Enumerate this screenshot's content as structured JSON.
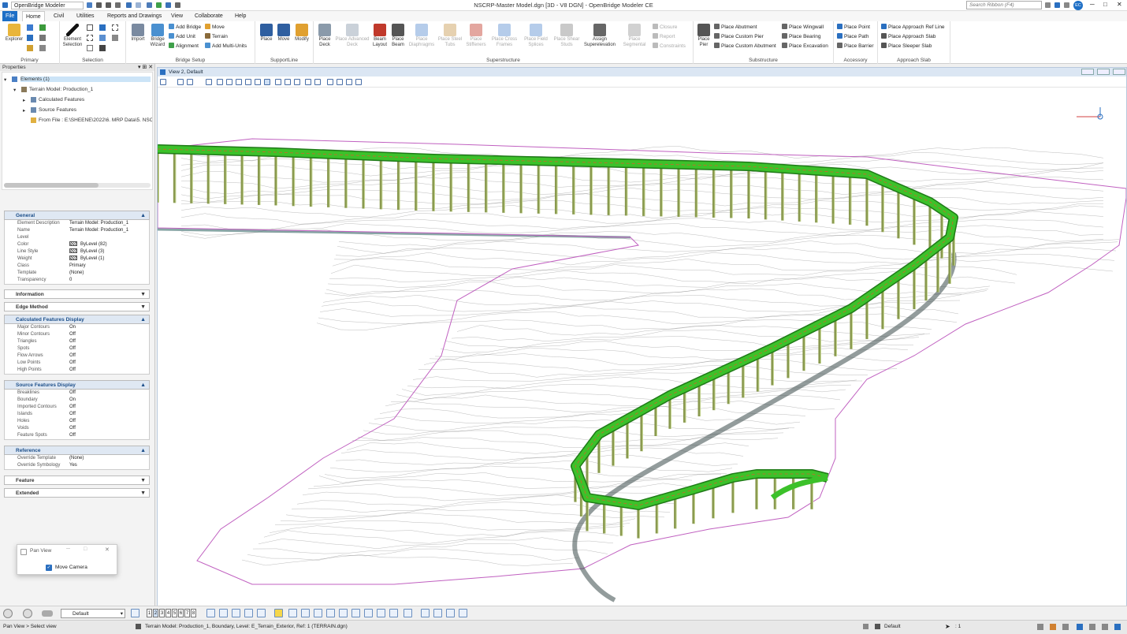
{
  "app": {
    "workspace": "OpenBridge Modeler",
    "title": "NSCRP-Master Model.dgn [3D - V8 DGN] - OpenBridge Modeler CE",
    "search_placeholder": "Search Ribbon (F4)",
    "user_initials": "EC"
  },
  "menu": {
    "tabs": [
      "File",
      "Home",
      "Civil",
      "Utilities",
      "Reports and Drawings",
      "View",
      "Collaborate",
      "Help"
    ],
    "active": "Home"
  },
  "ribbon": {
    "primary": {
      "label": "Primary",
      "explorer": "Explorer"
    },
    "selection": {
      "label": "Selection",
      "element_selection": "Element Selection"
    },
    "bridge_setup": {
      "label": "Bridge Setup",
      "import": "Import",
      "bridge_wizard": "Bridge Wizard",
      "add_bridge": "Add Bridge",
      "add_unit": "Add Unit",
      "alignment": "Alignment",
      "move": "Move",
      "terrain": "Terrain",
      "add_multi_units": "Add Multi-Units"
    },
    "supportline": {
      "label": "SupportLine",
      "place": "Place",
      "move": "Move",
      "modify": "Modify"
    },
    "superstructure": {
      "label": "Superstructure",
      "place_deck": "Place Deck",
      "place_advanced_deck": "Place Advanced Deck",
      "beam_layout": "Beam Layout",
      "place_beam": "Place Beam",
      "place_diaphragms": "Place Diaphragms",
      "place_steel_tubs": "Place Steel Tubs",
      "place_stiffeners": "Place Stiffeners",
      "place_cross_frames": "Place Cross Frames",
      "place_field_splices": "Place Field Splices",
      "place_shear_studs": "Place Shear Studs",
      "assign_superelevation": "Assign Superelevation",
      "place_segmental": "Place Segmental",
      "closure": "Closure",
      "report": "Report",
      "constraints": "Constraints"
    },
    "substructure": {
      "label": "Substructure",
      "place_pier": "Place Pier",
      "place_abutment": "Place Abutment",
      "place_custom_pier": "Place Custom Pier",
      "place_custom_abutment": "Place Custom Abutment",
      "place_wingwall": "Place Wingwall",
      "place_bearing": "Place Bearing",
      "place_excavation": "Place Excavation"
    },
    "accessory": {
      "label": "Accessory",
      "place_point": "Place Point",
      "place_path": "Place Path",
      "place_barrier": "Place Barrier"
    },
    "approach_slab": {
      "label": "Approach Slab",
      "place_approach_ref_line": "Place Approach Ref Line",
      "place_approach_slab": "Place Approach Slab",
      "place_sleeper_slab": "Place Sleeper Slab"
    }
  },
  "properties": {
    "title": "Properties",
    "tree": {
      "root": "Elements (1)",
      "terrain": "Terrain Model: Production_1",
      "calculated": "Calculated Features",
      "source": "Source Features",
      "from_file": "From File : E:\\SHEENE\\2022\\6. MRP Data\\5. NSCF"
    },
    "general": {
      "title": "General",
      "rows": [
        {
          "k": "Element Description",
          "v": "Terrain Model: Production_1"
        },
        {
          "k": "Name",
          "v": "Terrain Model: Production_1"
        },
        {
          "k": "Level",
          "v": ""
        },
        {
          "k": "Color",
          "v": "ByLevel (82)",
          "sw": true
        },
        {
          "k": "Line Style",
          "v": "ByLevel (3)",
          "sw": true
        },
        {
          "k": "Weight",
          "v": "ByLevel (1)",
          "sw": true
        },
        {
          "k": "Class",
          "v": "Primary"
        },
        {
          "k": "Template",
          "v": "(None)"
        },
        {
          "k": "Transparency",
          "v": "0"
        }
      ]
    },
    "information": "Information",
    "edge_method": "Edge Method",
    "calculated_display": {
      "title": "Calculated Features Display",
      "rows": [
        {
          "k": "Major Contours",
          "v": "On"
        },
        {
          "k": "Minor Contours",
          "v": "Off"
        },
        {
          "k": "Triangles",
          "v": "Off"
        },
        {
          "k": "Spots",
          "v": "Off"
        },
        {
          "k": "Flow Arrows",
          "v": "Off"
        },
        {
          "k": "Low Points",
          "v": "Off"
        },
        {
          "k": "High Points",
          "v": "Off"
        }
      ]
    },
    "source_display": {
      "title": "Source Features Display",
      "rows": [
        {
          "k": "Breaklines",
          "v": "Off"
        },
        {
          "k": "Boundary",
          "v": "On"
        },
        {
          "k": "Imported Contours",
          "v": "Off"
        },
        {
          "k": "Islands",
          "v": "Off"
        },
        {
          "k": "Holes",
          "v": "Off"
        },
        {
          "k": "Voids",
          "v": "Off"
        },
        {
          "k": "Feature Spots",
          "v": "Off"
        }
      ]
    },
    "reference": {
      "title": "Reference",
      "rows": [
        {
          "k": "Override Template",
          "v": "(None)"
        },
        {
          "k": "Override Symbology",
          "v": "Yes"
        }
      ]
    },
    "feature": "Feature",
    "extended": "Extended"
  },
  "pan_view": {
    "title": "Pan View",
    "option": "Move Camera",
    "checked": true
  },
  "view": {
    "title": "View 2, Default"
  },
  "bottom": {
    "model": "Default",
    "view_numbers": [
      "1",
      "2",
      "3",
      "4",
      "5",
      "6",
      "7",
      "8"
    ]
  },
  "status": {
    "left": "Pan View > Select view",
    "message": "Terrain Model: Production_1, Boundary, Level: E_Terrain_Exterior, Ref: 1 (TERRAIN.dgn)",
    "level": "Default",
    "scale": ": 1"
  },
  "colors": {
    "accent": "#1e6fc6",
    "deck": "#3cc12a",
    "pier": "#8a9a50",
    "boundary": "#c060c0"
  }
}
